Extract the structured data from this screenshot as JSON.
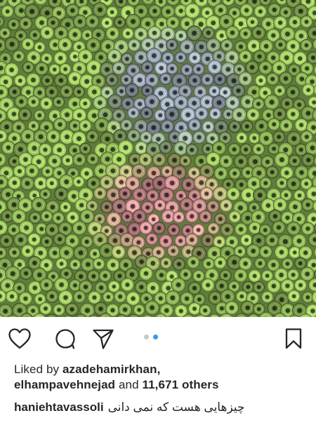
{
  "post": {
    "image_alt": "Close-up of green, gray and pink coral polyps",
    "palette": {
      "green": "#8db356",
      "gray": "#8f9aa6",
      "pink": "#c98a8c",
      "background": "#ffffff",
      "carousel_active": "#3897f0",
      "carousel_inactive": "#c7c7c7"
    },
    "carousel": {
      "count": 2,
      "active_index": 1
    }
  },
  "actions": {
    "like_icon": "heart-outline-icon",
    "comment_icon": "speech-bubble-icon",
    "share_icon": "paper-plane-icon",
    "save_icon": "bookmark-outline-icon"
  },
  "likes": {
    "prefix": "Liked by",
    "first_user": "azadehamirkhan,",
    "second_user": "elhampavehnejad",
    "joiner": "and",
    "count_text": "11,671 others"
  },
  "caption": {
    "username": "haniehtavassoli",
    "text": "چیزهایی هست که نمی دانی"
  }
}
